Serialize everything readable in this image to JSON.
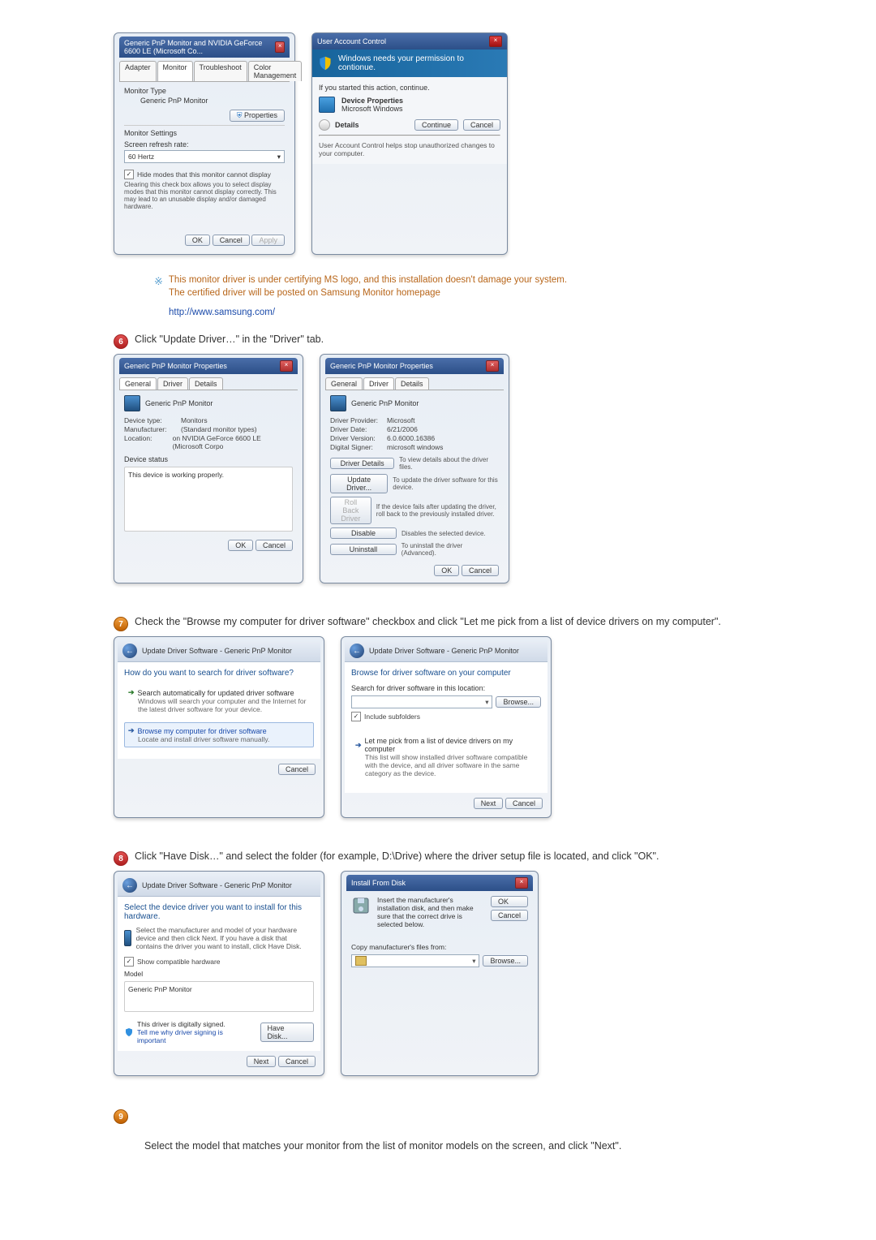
{
  "win_monitor_props": {
    "title": "Generic PnP Monitor and NVIDIA GeForce 6600 LE (Microsoft Co...",
    "tabs": [
      "Adapter",
      "Monitor",
      "Troubleshoot",
      "Color Management"
    ],
    "monitor_type_label": "Monitor Type",
    "monitor_type_value": "Generic PnP Monitor",
    "properties_btn": "Properties",
    "monitor_settings_label": "Monitor Settings",
    "refresh_label": "Screen refresh rate:",
    "refresh_value": "60 Hertz",
    "hide_modes_chk": "Hide modes that this monitor cannot display",
    "hide_modes_desc": "Clearing this check box allows you to select display modes that this monitor cannot display correctly. This may lead to an unusable display and/or damaged hardware.",
    "ok": "OK",
    "cancel": "Cancel",
    "apply": "Apply"
  },
  "uac": {
    "title": "User Account Control",
    "banner": "Windows needs your permission to contionue.",
    "started": "If you started this action, continue.",
    "app_name": "Device Properties",
    "app_pub": "Microsoft Windows",
    "details": "Details",
    "continue": "Continue",
    "cancel": "Cancel",
    "footer": "User Account Control helps stop unauthorized changes to your computer."
  },
  "note": {
    "main": "This monitor driver is under certifying MS logo, and this installation doesn't damage your system.",
    "sub": "The certified driver will be posted on Samsung Monitor homepage",
    "link": "http://www.samsung.com/"
  },
  "step6": "Click \"Update Driver…\" in the \"Driver\" tab.",
  "step7": "Check the \"Browse my computer for driver software\" checkbox and click \"Let me pick from a list of device drivers on my computer\".",
  "step8": "Click \"Have Disk…\" and select the folder (for example, D:\\Drive) where the driver setup file is located, and click \"OK\".",
  "step9_text": "Select the model that matches your monitor from the list of monitor models on the screen, and click \"Next\".",
  "props_general": {
    "title": "Generic PnP Monitor Properties",
    "tabs": [
      "General",
      "Driver",
      "Details"
    ],
    "heading": "Generic PnP Monitor",
    "device_type_k": "Device type:",
    "device_type_v": "Monitors",
    "manufacturer_k": "Manufacturer:",
    "manufacturer_v": "(Standard monitor types)",
    "location_k": "Location:",
    "location_v": "on NVIDIA GeForce 6600 LE (Microsoft Corpo",
    "status_label": "Device status",
    "status_text": "This device is working properly.",
    "ok": "OK",
    "cancel": "Cancel"
  },
  "props_driver": {
    "title": "Generic PnP Monitor Properties",
    "tabs": [
      "General",
      "Driver",
      "Details"
    ],
    "heading": "Generic PnP Monitor",
    "provider_k": "Driver Provider:",
    "provider_v": "Microsoft",
    "date_k": "Driver Date:",
    "date_v": "6/21/2006",
    "version_k": "Driver Version:",
    "version_v": "6.0.6000.16386",
    "signer_k": "Digital Signer:",
    "signer_v": "microsoft windows",
    "btn_details": "Driver Details",
    "btn_details_desc": "To view details about the driver files.",
    "btn_update": "Update Driver...",
    "btn_update_desc": "To update the driver software for this device.",
    "btn_rollback": "Roll Back Driver",
    "btn_rollback_desc": "If the device fails after updating the driver, roll back to the previously installed driver.",
    "btn_disable": "Disable",
    "btn_disable_desc": "Disables the selected device.",
    "btn_uninstall": "Uninstall",
    "btn_uninstall_desc": "To uninstall the driver (Advanced).",
    "ok": "OK",
    "cancel": "Cancel"
  },
  "update_search": {
    "crumb": "Update Driver Software - Generic PnP Monitor",
    "heading": "How do you want to search for driver software?",
    "opt1_title": "Search automatically for updated driver software",
    "opt1_desc": "Windows will search your computer and the Internet for the latest driver software for your device.",
    "opt2_title": "Browse my computer for driver software",
    "opt2_desc": "Locate and install driver software manually.",
    "cancel": "Cancel"
  },
  "update_browse": {
    "crumb": "Update Driver Software - Generic PnP Monitor",
    "heading": "Browse for driver software on your computer",
    "loc_label": "Search for driver software in this location:",
    "browse": "Browse...",
    "include_sub": "Include subfolders",
    "pick_title": "Let me pick from a list of device drivers on my computer",
    "pick_desc": "This list will show installed driver software compatible with the device, and all driver software in the same category as the device.",
    "next": "Next",
    "cancel": "Cancel"
  },
  "select_model": {
    "crumb": "Update Driver Software - Generic PnP Monitor",
    "heading": "Select the device driver you want to install for this hardware.",
    "desc": "Select the manufacturer and model of your hardware device and then click Next. If you have a disk that contains the driver you want to install, click Have Disk.",
    "compat_chk": "Show compatible hardware",
    "model_label": "Model",
    "model_item": "Generic PnP Monitor",
    "signed": "This driver is digitally signed.",
    "tell_me": "Tell me why driver signing is important",
    "have_disk": "Have Disk...",
    "next": "Next",
    "cancel": "Cancel"
  },
  "install_disk": {
    "title": "Install From Disk",
    "text": "Insert the manufacturer's installation disk, and then make sure that the correct drive is selected below.",
    "ok": "OK",
    "cancel": "Cancel",
    "copy_label": "Copy manufacturer's files from:",
    "browse": "Browse..."
  }
}
